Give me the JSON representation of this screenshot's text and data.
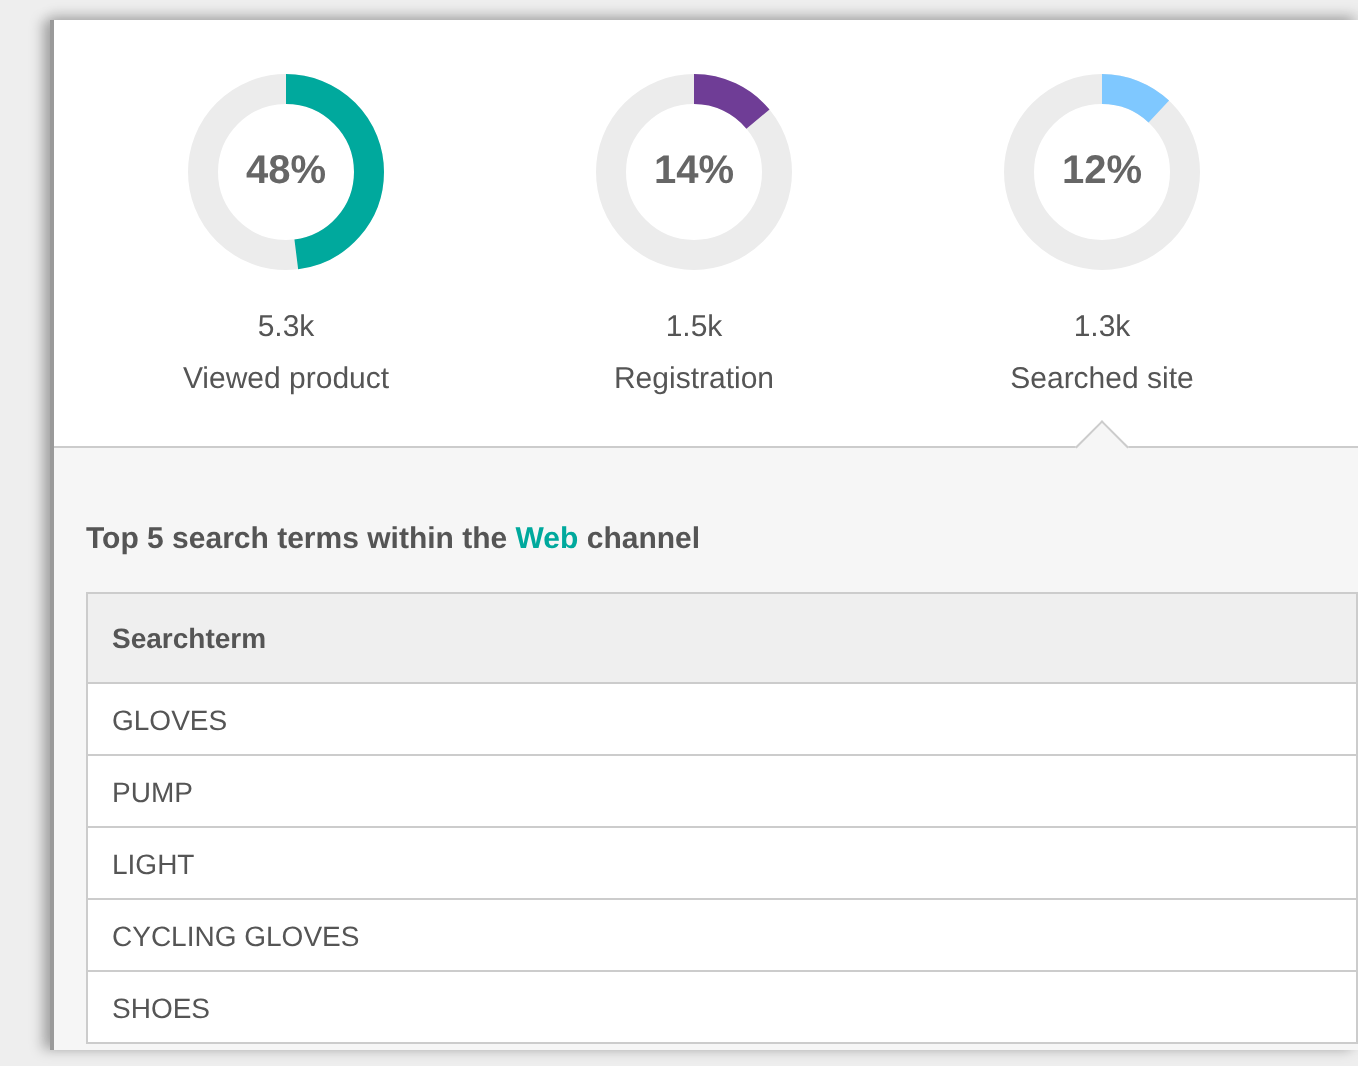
{
  "metrics": [
    {
      "percent": "48%",
      "level": 0.48,
      "color": "#00a99d",
      "value": "5.3k",
      "label": "Viewed product",
      "selected": false
    },
    {
      "percent": "14%",
      "level": 0.14,
      "color": "#6f3d96",
      "value": "1.5k",
      "label": "Registration",
      "selected": false
    },
    {
      "percent": "12%",
      "level": 0.12,
      "color": "#7fc8ff",
      "value": "1.3k",
      "label": "Searched site",
      "selected": true
    }
  ],
  "heading": {
    "before": "Top 5 search terms within the ",
    "channel": "Web",
    "after": " channel"
  },
  "table": {
    "columns": [
      "Searchterm"
    ],
    "rows": [
      [
        "GLOVES"
      ],
      [
        "PUMP"
      ],
      [
        "LIGHT"
      ],
      [
        "CYCLING GLOVES"
      ],
      [
        "SHOES"
      ]
    ]
  }
}
